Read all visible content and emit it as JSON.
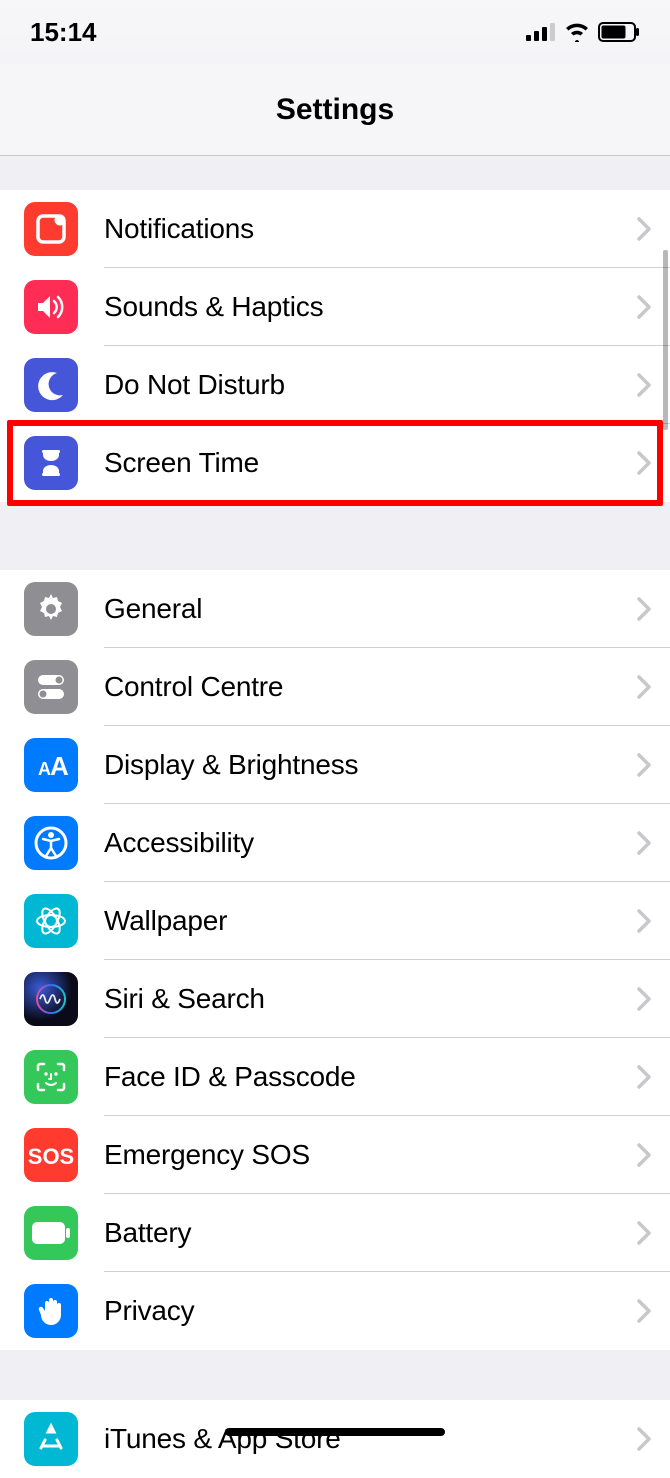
{
  "statusBar": {
    "time": "15:14"
  },
  "navBar": {
    "title": "Settings"
  },
  "groups": [
    {
      "id": "g1",
      "items": [
        {
          "id": "notifications",
          "label": "Notifications",
          "icon": "notifications-icon",
          "color": "#ff3b30"
        },
        {
          "id": "sounds",
          "label": "Sounds & Haptics",
          "icon": "sounds-icon",
          "color": "#ff2d55"
        },
        {
          "id": "dnd",
          "label": "Do Not Disturb",
          "icon": "moon-icon",
          "color": "#4656d8"
        },
        {
          "id": "screentime",
          "label": "Screen Time",
          "icon": "hourglass-icon",
          "color": "#4656d8",
          "highlighted": true
        }
      ]
    },
    {
      "id": "g2",
      "items": [
        {
          "id": "general",
          "label": "General",
          "icon": "gear-icon",
          "color": "#8e8e93"
        },
        {
          "id": "controlcentre",
          "label": "Control Centre",
          "icon": "switches-icon",
          "color": "#8e8e93"
        },
        {
          "id": "display",
          "label": "Display & Brightness",
          "icon": "text-size-icon",
          "color": "#007aff"
        },
        {
          "id": "accessibility",
          "label": "Accessibility",
          "icon": "accessibility-icon",
          "color": "#007aff"
        },
        {
          "id": "wallpaper",
          "label": "Wallpaper",
          "icon": "wallpaper-icon",
          "color": "#00b8d4"
        },
        {
          "id": "siri",
          "label": "Siri & Search",
          "icon": "siri-icon",
          "color": "siri"
        },
        {
          "id": "faceid",
          "label": "Face ID & Passcode",
          "icon": "face-id-icon",
          "color": "#34c759"
        },
        {
          "id": "sos",
          "label": "Emergency SOS",
          "icon": "sos-icon",
          "color": "#ff3b30"
        },
        {
          "id": "battery",
          "label": "Battery",
          "icon": "battery-icon",
          "color": "#34c759"
        },
        {
          "id": "privacy",
          "label": "Privacy",
          "icon": "hand-icon",
          "color": "#007aff"
        }
      ]
    },
    {
      "id": "g3",
      "items": [
        {
          "id": "itunes",
          "label": "iTunes & App Store",
          "icon": "appstore-icon",
          "color": "#00b8d4"
        }
      ]
    }
  ]
}
